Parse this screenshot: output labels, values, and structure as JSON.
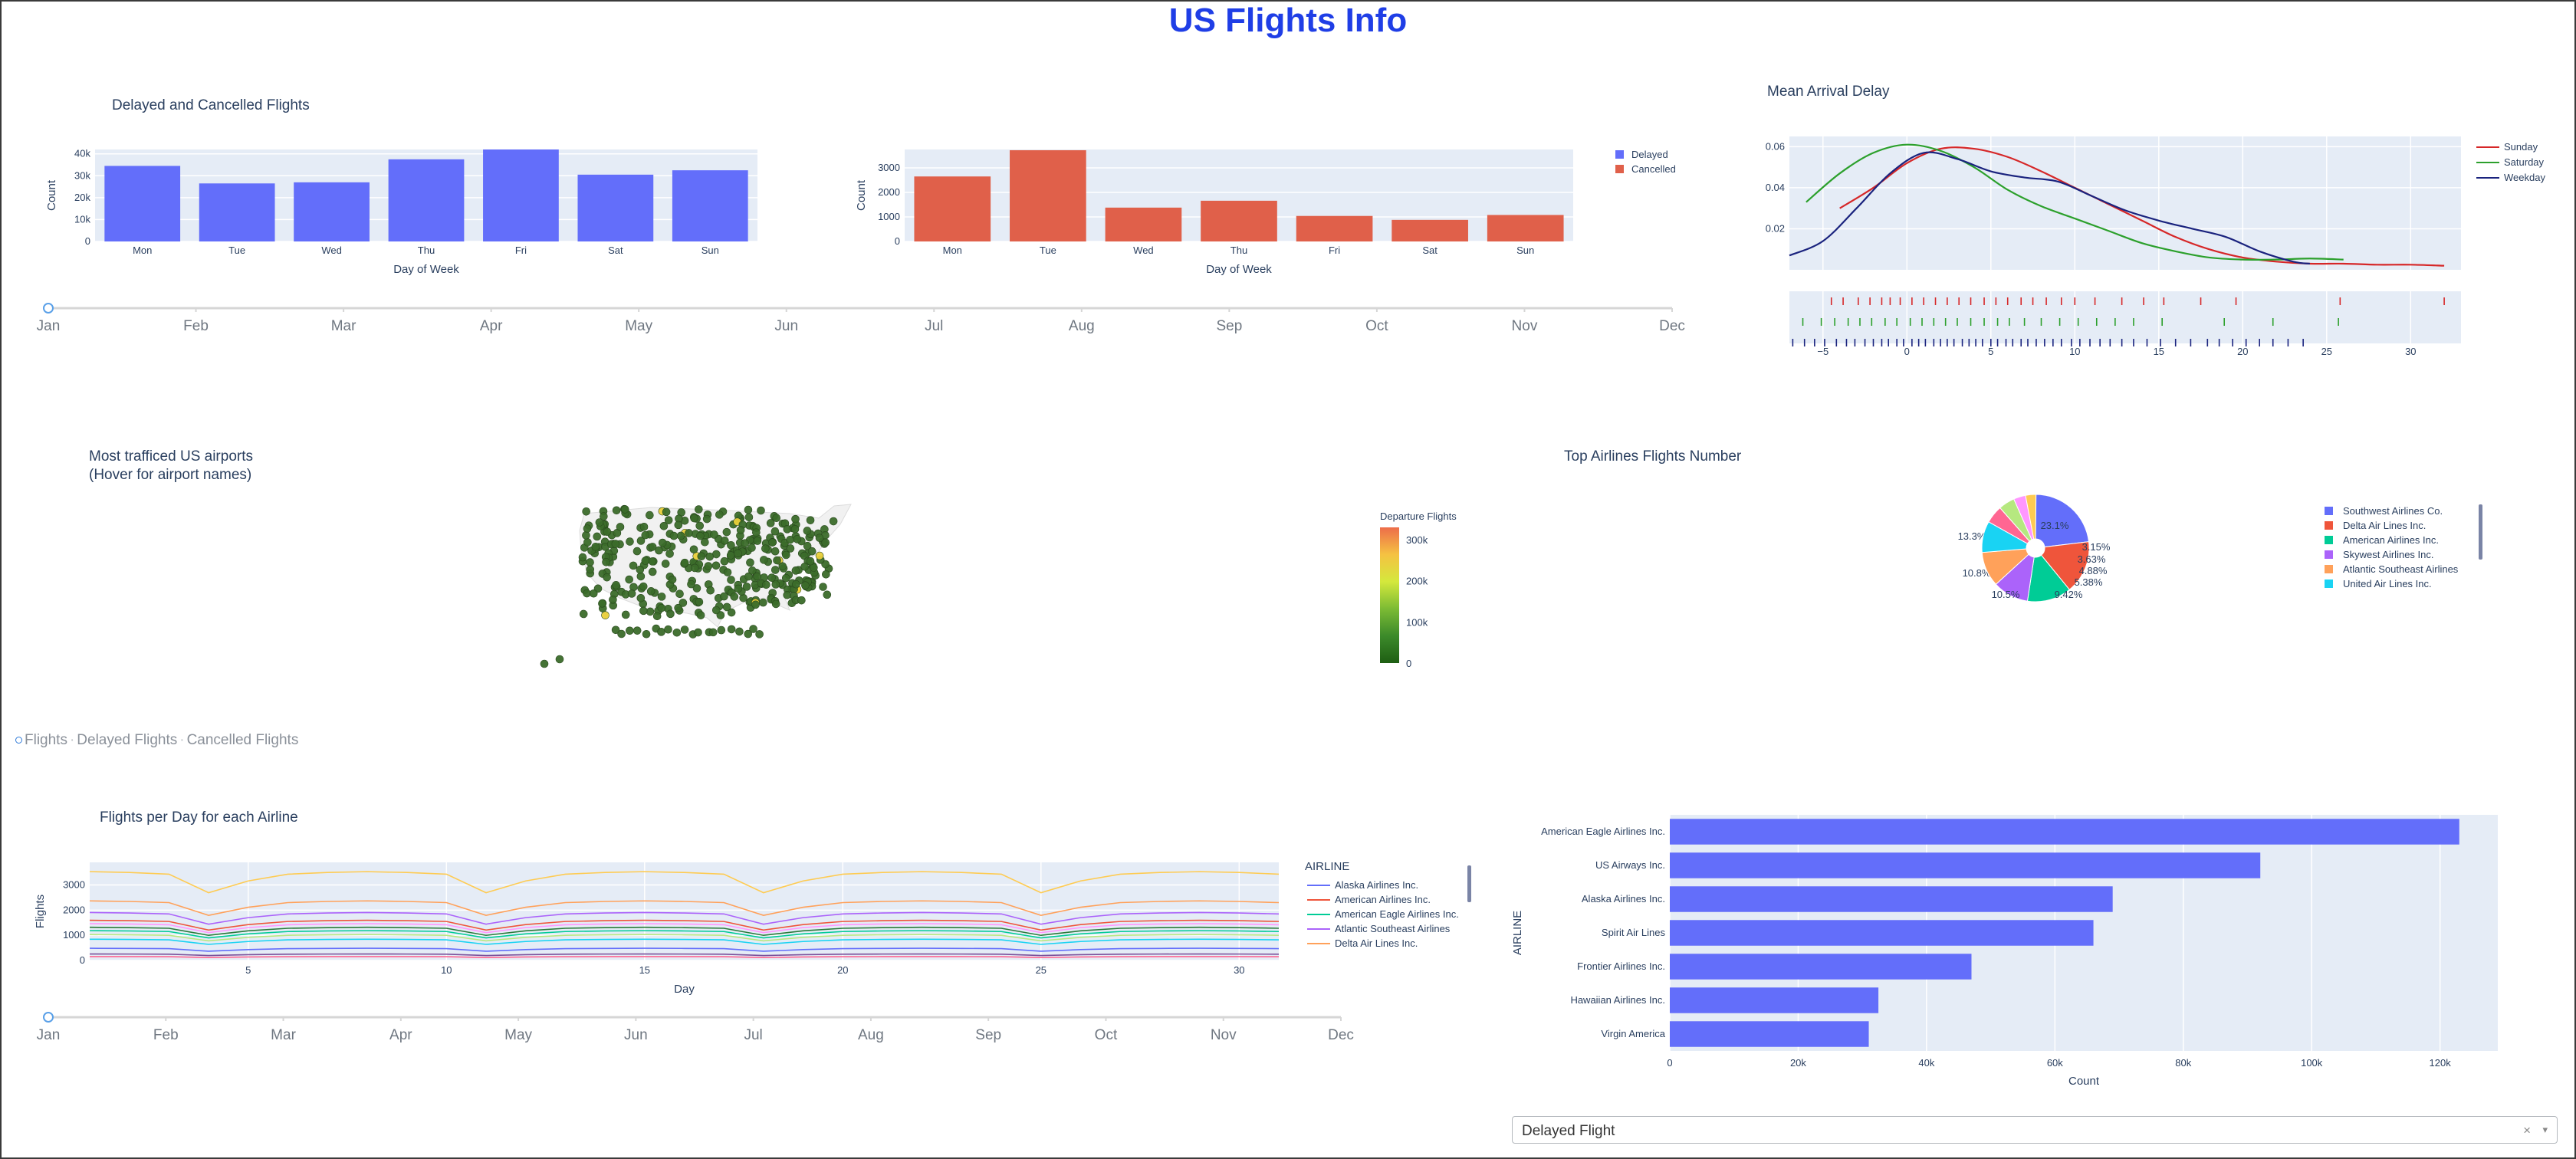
{
  "page": {
    "title": "US Flights Info"
  },
  "months": [
    "Jan",
    "Feb",
    "Mar",
    "Apr",
    "May",
    "Jun",
    "Jul",
    "Aug",
    "Sep",
    "Oct",
    "Nov",
    "Dec"
  ],
  "month_slider_top": {
    "selected": "Jan"
  },
  "month_slider_bottom": {
    "selected": "Jan"
  },
  "radio_options": {
    "items": [
      "Flights",
      "Delayed Flights",
      "Cancelled Flights"
    ],
    "selected": "Flights"
  },
  "dropdown": {
    "value": "Delayed Flight",
    "clear_icon": "×",
    "caret_icon": "▾"
  },
  "colors": {
    "blue": "#636efa",
    "red": "#e0604a",
    "title_blue": "#1f3ee6"
  },
  "chart_data": [
    {
      "id": "delayed_cancelled",
      "type": "bar",
      "title": "Delayed and Cancelled Flights",
      "xlabel": "Day of Week",
      "ylabel": "Count",
      "categories": [
        "Mon",
        "Tue",
        "Wed",
        "Thu",
        "Fri",
        "Sat",
        "Sun"
      ],
      "legend": [
        "Delayed",
        "Cancelled"
      ],
      "subplots": [
        {
          "series": "Delayed",
          "color": "#636efa",
          "values": [
            34500,
            26500,
            27000,
            37500,
            42000,
            30500,
            32500
          ],
          "ylim": [
            0,
            42000
          ],
          "yticks": [
            0,
            10000,
            20000,
            30000,
            40000
          ],
          "ytick_labels": [
            "0",
            "10k",
            "20k",
            "30k",
            "40k"
          ]
        },
        {
          "series": "Cancelled",
          "color": "#e0604a",
          "values": [
            2650,
            3720,
            1380,
            1660,
            1040,
            880,
            1080
          ],
          "ylim": [
            0,
            3750
          ],
          "yticks": [
            0,
            1000,
            2000,
            3000
          ],
          "ytick_labels": [
            "0",
            "1000",
            "2000",
            "3000"
          ]
        }
      ]
    },
    {
      "id": "mean_arrival_delay",
      "type": "line",
      "title": "Mean Arrival Delay",
      "xlim": [
        -7,
        33
      ],
      "ylim": [
        0,
        0.065
      ],
      "yticks": [
        0.02,
        0.04,
        0.06
      ],
      "ytick_labels": [
        "0.02",
        "0.04",
        "0.06"
      ],
      "xticks": [
        -5,
        0,
        5,
        10,
        15,
        20,
        25,
        30
      ],
      "xtick_labels": [
        "−5",
        "0",
        "5",
        "10",
        "15",
        "20",
        "25",
        "30"
      ],
      "series": [
        {
          "name": "Sunday",
          "color": "#d62728",
          "x": [
            -4,
            -2,
            0,
            2,
            4,
            6,
            8,
            10,
            12,
            14,
            16,
            18,
            20,
            22,
            24,
            26,
            28,
            30,
            32
          ],
          "y": [
            0.03,
            0.04,
            0.052,
            0.059,
            0.059,
            0.055,
            0.048,
            0.04,
            0.032,
            0.024,
            0.016,
            0.01,
            0.006,
            0.004,
            0.003,
            0.003,
            0.0025,
            0.0025,
            0.002
          ]
        },
        {
          "name": "Saturday",
          "color": "#2ca02c",
          "x": [
            -6,
            -4,
            -2,
            0,
            2,
            4,
            6,
            8,
            10,
            12,
            14,
            16,
            18,
            20,
            22,
            24,
            26
          ],
          "y": [
            0.033,
            0.047,
            0.057,
            0.061,
            0.058,
            0.05,
            0.039,
            0.031,
            0.025,
            0.019,
            0.013,
            0.009,
            0.006,
            0.005,
            0.005,
            0.0055,
            0.005
          ]
        },
        {
          "name": "Weekday",
          "color": "#1a237e",
          "x": [
            -7,
            -5,
            -3,
            -1,
            1,
            3,
            5,
            7,
            9,
            11,
            13,
            15,
            17,
            19,
            21,
            23,
            24
          ],
          "y": [
            0.007,
            0.014,
            0.03,
            0.047,
            0.057,
            0.054,
            0.048,
            0.045,
            0.043,
            0.036,
            0.029,
            0.024,
            0.02,
            0.016,
            0.009,
            0.004,
            0.003
          ]
        }
      ],
      "rug": [
        {
          "name": "Sunday",
          "color": "#d62728",
          "x": [
            -4.5,
            -3.8,
            -2.9,
            -2.2,
            -1.5,
            -1,
            -0.4,
            0.3,
            1,
            1.7,
            2.4,
            3.1,
            3.8,
            4.6,
            5.3,
            6,
            6.8,
            7.5,
            8.3,
            9.2,
            10,
            11.2,
            12.8,
            14.1,
            15.3,
            17.5,
            19.6,
            25.8,
            32
          ]
        },
        {
          "name": "Saturday",
          "color": "#2ca02c",
          "x": [
            -6.2,
            -5.1,
            -4.3,
            -3.5,
            -2.8,
            -2.1,
            -1.3,
            -0.6,
            0.2,
            0.9,
            1.6,
            2.3,
            3,
            3.8,
            4.6,
            5.4,
            6.1,
            7,
            8,
            9.1,
            10.2,
            11.3,
            12.4,
            13.5,
            15.2,
            18.9,
            21.8,
            25.7
          ]
        },
        {
          "name": "Weekday",
          "color": "#1a237e",
          "x": [
            -6.8,
            -6.1,
            -5.5,
            -4.9,
            -4.2,
            -3.6,
            -3.1,
            -2.5,
            -2,
            -1.5,
            -1.1,
            -0.6,
            -0.2,
            0.3,
            0.7,
            1.1,
            1.6,
            2,
            2.4,
            2.8,
            3.3,
            3.7,
            4.1,
            4.5,
            5,
            5.4,
            5.9,
            6.3,
            6.8,
            7.2,
            7.7,
            8.2,
            8.7,
            9.2,
            9.8,
            10.3,
            10.9,
            11.5,
            12.1,
            12.8,
            13.5,
            14.3,
            15.1,
            16,
            16.9,
            17.9,
            18.6,
            19.4,
            20.2,
            21,
            21.8,
            22.7,
            23.6
          ]
        }
      ]
    },
    {
      "id": "airports_map",
      "type": "scatter",
      "title_lines": [
        "Most trafficed US airports",
        "(Hover for airport names)"
      ],
      "colorbar_title": "Departure Flights",
      "colorbar_ticks": [
        0,
        100000,
        200000,
        300000
      ],
      "colorbar_tick_labels": [
        "0",
        "100k",
        "200k",
        "300k"
      ],
      "colorscale": [
        "#1e5e13",
        "#3c8a2a",
        "#7cbb34",
        "#d4e83c",
        "#f5c242",
        "#ed6d4a"
      ]
    },
    {
      "id": "top_airlines",
      "type": "pie",
      "title": "Top Airlines Flights Number",
      "slices": [
        {
          "label": "Southwest Airlines Co.",
          "pct": 23.1,
          "text": "23.1%",
          "color": "#636efa"
        },
        {
          "label": "Delta Air Lines Inc.",
          "pct": 16.0,
          "text": "16%",
          "color": "#ef553b"
        },
        {
          "label": "American Airlines Inc.",
          "pct": 13.3,
          "text": "13.3%",
          "color": "#00cc96"
        },
        {
          "label": "Skywest Airlines Inc.",
          "pct": 10.8,
          "text": "10.8%",
          "color": "#ab63fa"
        },
        {
          "label": "Atlantic Southeast Airlines",
          "pct": 10.5,
          "text": "10.5%",
          "color": "#ffa15a"
        },
        {
          "label": "United Air Lines Inc.",
          "pct": 9.42,
          "text": "9.42%",
          "color": "#19d3f3"
        },
        {
          "label": "",
          "pct": 5.38,
          "text": "5.38%",
          "color": "#ff6692"
        },
        {
          "label": "",
          "pct": 4.88,
          "text": "4.88%",
          "color": "#b6e880"
        },
        {
          "label": "",
          "pct": 3.63,
          "text": "3.63%",
          "color": "#ff97ff"
        },
        {
          "label": "",
          "pct": 3.15,
          "text": "3.15%",
          "color": "#fecb52"
        }
      ]
    },
    {
      "id": "flights_per_day",
      "type": "line",
      "title": "Flights per Day for each Airline",
      "xlabel": "Day",
      "ylabel": "Flights",
      "xlim": [
        1,
        31
      ],
      "ylim": [
        0,
        3900
      ],
      "xticks": [
        5,
        10,
        15,
        20,
        25,
        30
      ],
      "xtick_labels": [
        "5",
        "10",
        "15",
        "20",
        "25",
        "30"
      ],
      "yticks": [
        0,
        1000,
        2000,
        3000
      ],
      "ytick_labels": [
        "0",
        "1000",
        "2000",
        "3000"
      ],
      "legend_title": "AIRLINE",
      "series": [
        {
          "name": "Alaska Airlines Inc.",
          "color": "#636efa",
          "base": 470
        },
        {
          "name": "American Airlines Inc.",
          "color": "#ef553b",
          "base": 1550
        },
        {
          "name": "American Eagle Airlines Inc.",
          "color": "#00cc96",
          "base": 1150
        },
        {
          "name": "Atlantic Southeast Airlines",
          "color": "#ab63fa",
          "base": 1850
        },
        {
          "name": "Delta Air Lines Inc.",
          "color": "#ffa15a",
          "base": 2300
        },
        {
          "name": "",
          "color": "#fecb52",
          "base": 3350
        },
        {
          "name": "",
          "color": "#19d3f3",
          "base": 820
        },
        {
          "name": "",
          "color": "#2a7a3a",
          "base": 1280
        },
        {
          "name": "",
          "color": "#b6e880",
          "base": 1000
        },
        {
          "name": "",
          "color": "#ff97ff",
          "base": 1420
        },
        {
          "name": "",
          "color": "#7a4f9a",
          "base": 250
        },
        {
          "name": "",
          "color": "#ff6692",
          "base": 150
        }
      ],
      "weekly_pattern": [
        1.0,
        1.02,
        1.03,
        1.02,
        1.0,
        0.78,
        0.92
      ]
    },
    {
      "id": "delayed_by_airline",
      "type": "bar",
      "orientation": "h",
      "xlabel": "Count",
      "ylabel": "AIRLINE",
      "categories": [
        "American Eagle Airlines Inc.",
        "US Airways Inc.",
        "Alaska Airlines Inc.",
        "Spirit Air Lines",
        "Frontier Airlines Inc.",
        "Hawaiian Airlines Inc.",
        "Virgin America"
      ],
      "values": [
        123000,
        92000,
        69000,
        66000,
        47000,
        32500,
        31000
      ],
      "xlim": [
        0,
        129000
      ],
      "xticks": [
        0,
        20000,
        40000,
        60000,
        80000,
        100000,
        120000
      ],
      "xtick_labels": [
        "0",
        "20k",
        "40k",
        "60k",
        "80k",
        "100k",
        "120k"
      ]
    }
  ]
}
